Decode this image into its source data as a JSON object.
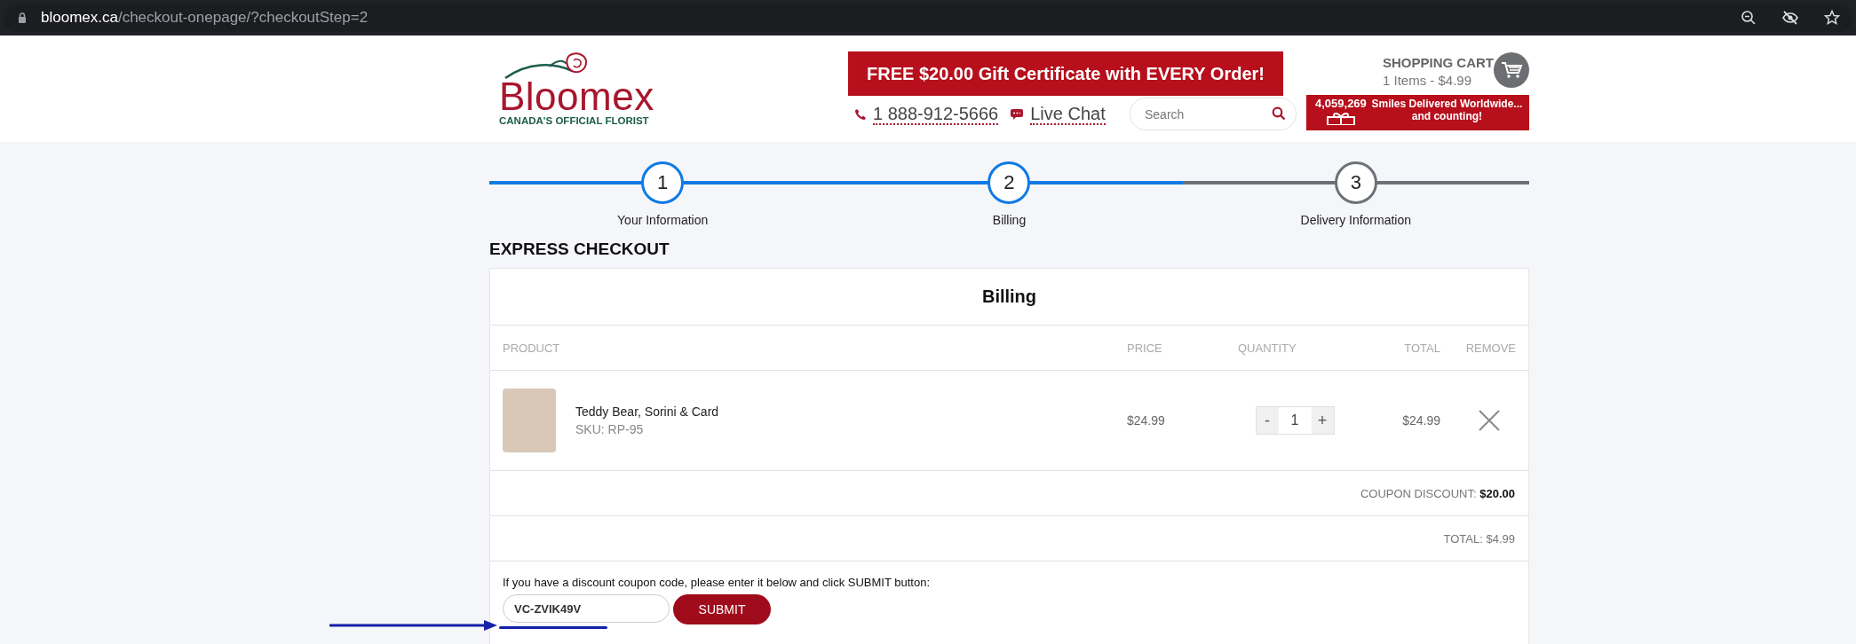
{
  "browser": {
    "url_domain": "bloomex.ca",
    "url_path": "/checkout-onepage/?checkoutStep=2"
  },
  "header": {
    "logo": {
      "name": "Bloomex",
      "tagline": "CANADA'S OFFICIAL FLORIST"
    },
    "promo_banner": "FREE $20.00 Gift Certificate with EVERY Order!",
    "phone": "1 888-912-5666",
    "live_chat": "Live Chat",
    "search": {
      "placeholder": "Search"
    },
    "cart": {
      "title": "SHOPPING CART",
      "summary": "1 Items - $4.99"
    },
    "counter_banner": {
      "count": "4,059,269",
      "line_1": "Smiles Delivered Worldwide...",
      "line_2": "and counting!"
    }
  },
  "steps": [
    {
      "number": "1",
      "label": "Your Information",
      "done": true
    },
    {
      "number": "2",
      "label": "Billing",
      "done": true
    },
    {
      "number": "3",
      "label": "Delivery Information",
      "done": false
    }
  ],
  "section_title": "EXPRESS CHECKOUT",
  "card": {
    "title": "Billing",
    "columns": [
      "PRODUCT",
      "PRICE",
      "QUANTITY",
      "TOTAL",
      "REMOVE"
    ],
    "rows": [
      {
        "name": "Teddy Bear, Sorini & Card",
        "sku": "SKU: RP-95",
        "price": "$24.99",
        "quantity": "1",
        "minus": "-",
        "plus": "+",
        "total": "$24.99"
      }
    ],
    "coupon_discount": {
      "label": "COUPON DISCOUNT: ",
      "value": "$20.00"
    },
    "total": "TOTAL: $4.99",
    "coupon": {
      "prompt": "If you have a discount coupon code, please enter it below and click SUBMIT button:",
      "value": "VC-ZVIK49V",
      "button": "SUBMIT"
    }
  }
}
